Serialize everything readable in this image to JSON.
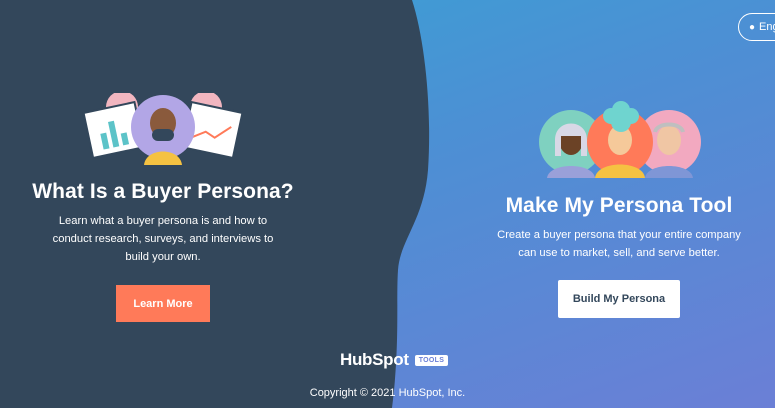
{
  "language_button": {
    "label": "Eng",
    "icon": "globe-icon"
  },
  "left_panel": {
    "title": "What Is a Buyer Persona?",
    "description_lines": [
      "Learn what a buyer persona is and how to",
      "conduct research, surveys, and interviews to",
      "build your own."
    ],
    "button_label": "Learn More"
  },
  "right_panel": {
    "title": "Make My Persona Tool",
    "description_lines": [
      "Create a buyer persona that your entire company",
      "can use to market, sell, and serve better."
    ],
    "button_label": "Build My Persona"
  },
  "footer": {
    "logo_text": "HubSpot",
    "badge": "TOOLS",
    "copyright": "Copyright © 2021 HubSpot, Inc."
  },
  "colors": {
    "dark_panel": "#33475b",
    "accent_orange": "#ff7a59",
    "gradient_start": "#36a4d4",
    "gradient_end": "#6b7fd6"
  }
}
